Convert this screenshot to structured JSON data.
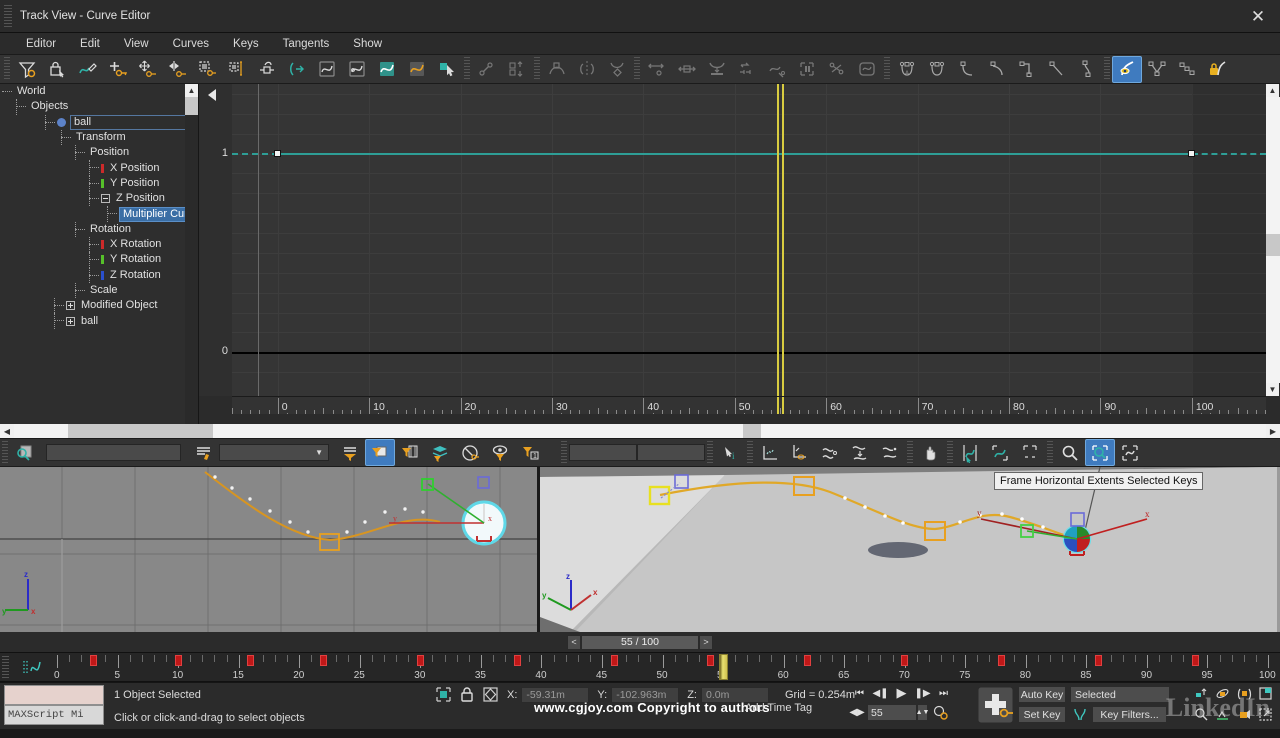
{
  "window": {
    "title": "Track View - Curve Editor",
    "close_icon": "close-icon"
  },
  "menubar": {
    "items": [
      "Editor",
      "Edit",
      "View",
      "Curves",
      "Keys",
      "Tangents",
      "Show"
    ]
  },
  "toolbar": {
    "groups": [
      [
        "filters-icon",
        "lock-selection-icon",
        "draw-curves-icon",
        "add-keys-icon",
        "move-keys-icon",
        "slide-keys-icon",
        "scale-keys-icon",
        "scale-values-icon",
        "snap-frames-icon",
        "parameter-curve-out-of-range-icon",
        "show-tangents-icon",
        "lock-tangents-icon",
        "show-curves-icon",
        "unify-tangents-icon",
        "select-arrow-icon"
      ],
      [
        "reduce-keys-icon",
        "move-up-down-icon"
      ],
      [
        "ease-curve-icon",
        "mirror-curve-icon",
        "multiplier-curve-icon"
      ],
      [
        "align-keys-icon",
        "stretch-keys-icon",
        "flatten-keys-icon",
        "scale-region-icon",
        "add-ease-curve-icon",
        "region-tool-icon",
        "randomize-keys-icon",
        "loop-curve-icon"
      ],
      [
        "tangent-auto-icon",
        "tangent-custom-icon",
        "tangent-fast-icon",
        "tangent-slow-icon",
        "tangent-step-icon",
        "tangent-linear-icon",
        "tangent-smooth-icon"
      ],
      [
        "show-selected-key-stats-icon",
        "tangent-split-icon",
        "tangent-node-icon",
        "lock-key-icon"
      ]
    ],
    "active_index": "tangent-visibility"
  },
  "tree": {
    "rows": [
      {
        "label": "World",
        "indent": 14,
        "style": "plain"
      },
      {
        "label": "Objects",
        "indent": 28,
        "style": "plain"
      },
      {
        "label": "ball",
        "indent": 57,
        "style": "boxed",
        "icon": "object-dot-icon"
      },
      {
        "label": "Transform",
        "indent": 73,
        "style": "plain"
      },
      {
        "label": "Position",
        "indent": 87,
        "style": "plain"
      },
      {
        "label": "X Position",
        "indent": 101,
        "style": "plain",
        "bar": "#cc2a2a"
      },
      {
        "label": "Y Position",
        "indent": 101,
        "style": "plain",
        "bar": "#56c02a"
      },
      {
        "label": "Z Position",
        "indent": 101,
        "style": "plain",
        "box": "minus"
      },
      {
        "label": "Multiplier Curve",
        "indent": 119,
        "style": "selected"
      },
      {
        "label": "Rotation",
        "indent": 87,
        "style": "plain"
      },
      {
        "label": "X Rotation",
        "indent": 101,
        "style": "plain",
        "bar": "#cc2a2a"
      },
      {
        "label": "Y Rotation",
        "indent": 101,
        "style": "plain",
        "bar": "#56c02a"
      },
      {
        "label": "Z Rotation",
        "indent": 101,
        "style": "plain",
        "bar": "#2a4fcc"
      },
      {
        "label": "Scale",
        "indent": 87,
        "style": "plain"
      },
      {
        "label": "Modified Object",
        "indent": 66,
        "style": "plain",
        "box": "plus"
      },
      {
        "label": "ball",
        "indent": 66,
        "style": "plain",
        "box": "plus"
      }
    ]
  },
  "chart_data": {
    "type": "line",
    "title": "Multiplier Curve",
    "xlabel": "",
    "ylabel": "",
    "xlim": [
      -5,
      108
    ],
    "ylim": [
      -0.22,
      1.35
    ],
    "xticks": [
      0,
      10,
      20,
      30,
      40,
      50,
      60,
      70,
      80,
      90,
      100
    ],
    "yticks": [
      0,
      1
    ],
    "grid": true,
    "time_cursor_frame": 55,
    "series": [
      {
        "name": "Multiplier Curve (Z Position)",
        "color": "#2e9e96",
        "keys": [
          {
            "x": 0,
            "y": 1
          },
          {
            "x": 100,
            "y": 1
          }
        ],
        "x": [
          0,
          100
        ],
        "values": [
          1,
          1
        ],
        "out_of_range_dashed": true
      }
    ]
  },
  "lower_toolbar": {
    "search_placeholder": "",
    "search_value": "",
    "combo_value": "",
    "value_field_1": "",
    "value_field_2": "",
    "icons": [
      "zoom-region-icon",
      "name-filter-icon",
      "filter-combo-icon",
      "filter-selected-tracks-icon",
      "filter-selected-objects-icon",
      "filter-animated-tracks-icon",
      "filter-active-layer-icon",
      "filter-selected-keys-icon",
      "filter-visible-objects-icon",
      "filter-object-level-icon",
      "key-stats-icon",
      "show-keyable-icon",
      "show-tangents-toggle-icon",
      "soften-curve-icon",
      "reduce-curve-icon",
      "simplify-curve-icon",
      "pan-icon",
      "frame-horizontal-extents-keys-icon",
      "frame-horizontal-extents-icon",
      "frame-vertical-extents-icon",
      "zoom-icon",
      "zoom-region-active-icon",
      "zoom-value-extents-icon"
    ]
  },
  "tooltip": {
    "text": "Frame Horizontal Extents Selected Keys"
  },
  "viewports": {
    "left": {
      "name": "front-viewport",
      "axis": {
        "x": "x",
        "y": "y",
        "z": "z"
      }
    },
    "right": {
      "name": "perspective-viewport",
      "axis": {
        "x": "x",
        "y": "y",
        "z": "z"
      }
    }
  },
  "time_slider": {
    "prev_label": "<",
    "next_label": ">",
    "value": "55 / 100"
  },
  "trackbar": {
    "labels": [
      0,
      5,
      10,
      15,
      20,
      25,
      30,
      35,
      40,
      45,
      50,
      55,
      60,
      65,
      70,
      75,
      80,
      85,
      90,
      95,
      100
    ],
    "keys": [
      3,
      10,
      16,
      22,
      30,
      38,
      46,
      54,
      62,
      70,
      78,
      86,
      94
    ],
    "cursor_frame": 55,
    "range_start": 0,
    "range_end": 100,
    "curve-icon": "track-curve-icon"
  },
  "status": {
    "maxscript_label": "MAXScript Mi",
    "selection": "1 Object Selected",
    "prompt": "Click or click-and-drag to select objects",
    "coords": {
      "x_label": "X:",
      "x_value": "-59.31m",
      "y_label": "Y:",
      "y_value": "-102.963m",
      "z_label": "Z:",
      "z_value": "0.0m"
    },
    "grid": "Grid = 0.254m",
    "add_time_tag": "Add Time Tag",
    "watermark": "www.cgjoy.com Copyright to authors",
    "linkedin_watermark": "LinkedIn"
  },
  "anim_controls": {
    "frame_value": "55",
    "auto_key": "Auto Key",
    "set_key": "Set Key",
    "selection_set": "Selected",
    "key_filters": "Key Filters...",
    "buttons": [
      "go-to-start-icon",
      "previous-frame-icon",
      "play-animation-icon",
      "next-frame-icon",
      "go-to-end-icon",
      "time-configuration-icon",
      "key-mode-toggle-icon",
      "set-key-button-icon"
    ],
    "nav_icons": [
      "pan-view-icon",
      "orbit-icon",
      "zoom-all-icon",
      "maximize-viewport-icon",
      "zoom-extents-icon",
      "field-of-view-icon",
      "walkthrough-icon",
      "zoom-region-nav-icon"
    ]
  }
}
